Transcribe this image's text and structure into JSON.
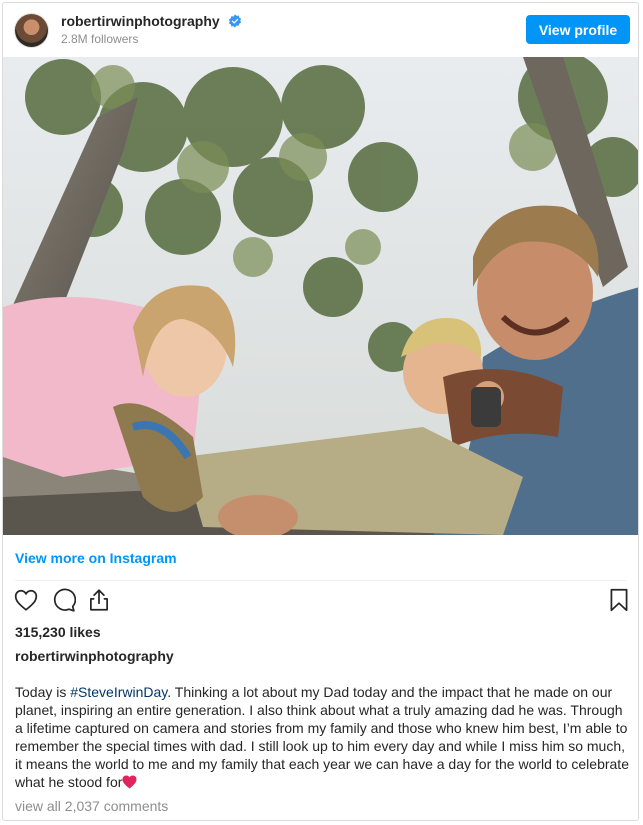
{
  "header": {
    "username": "robertirwinphotography",
    "followers": "2.8M followers",
    "view_profile_label": "View profile"
  },
  "post": {
    "view_more_label": "View more on Instagram",
    "likes": "315,230 likes",
    "caption_user": "robertirwinphotography",
    "caption_prefix": "Today is ",
    "hashtag": "#SteveIrwinDay",
    "caption_body": ". Thinking a lot about my Dad today and the impact that he made on our planet, inspiring an entire generation. I also think about what a truly amazing dad he was. Through a lifetime captured on camera and stories from my family and those who knew him best, I’m able to remember the special times with dad. I still look up to him every day and while I miss him so much, it means the world to me and my family that each year we can have a day for the world to celebrate what he stood for",
    "comments_link": "view all 2,037 comments"
  },
  "icons": {
    "verified": "verified-badge-icon",
    "like": "heart-outline-icon",
    "comment": "speech-bubble-icon",
    "share": "share-upload-icon",
    "save": "bookmark-icon",
    "caption_emoji": "red-heart-emoji"
  },
  "colors": {
    "accent": "#0095f6",
    "hashtag": "#00376b",
    "muted": "#8e8e8e",
    "heart": "#e0245e"
  }
}
